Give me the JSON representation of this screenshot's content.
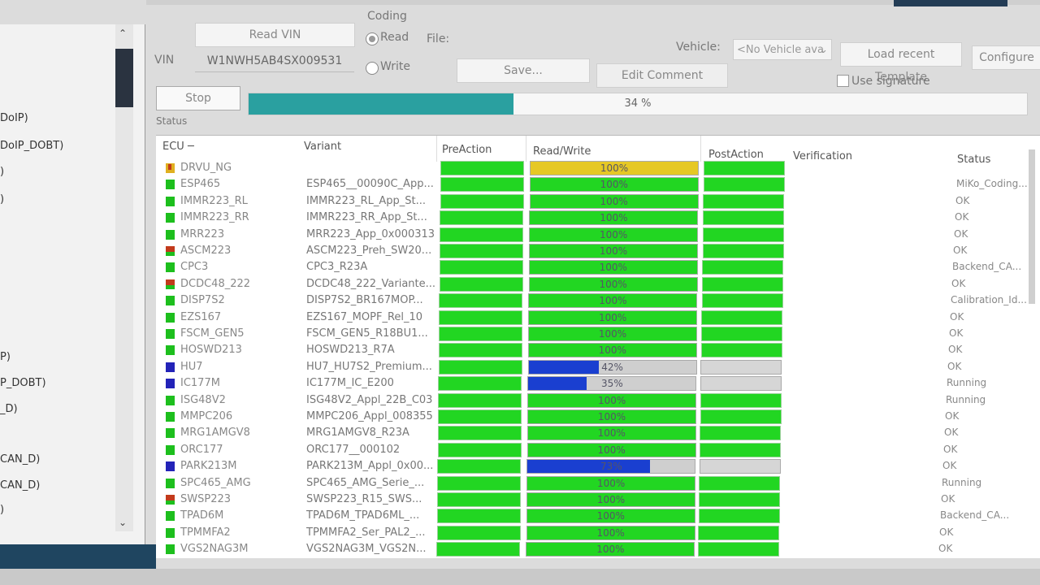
{
  "left_panel": {
    "items": [
      "DoIP)",
      "DoIP_DOBT)",
      ")",
      ")",
      "P)",
      "P_DOBT)",
      "_D)",
      "CAN_D)",
      "CAN_D)",
      ")"
    ]
  },
  "toolbar": {
    "read_vin_label": "Read VIN",
    "vin_label": "VIN",
    "vin_value": "W1NWH5AB4SX009531",
    "coding_label": "Coding",
    "read_label": "Read",
    "write_label": "Write",
    "file_label": "File:",
    "save_label": "Save...",
    "edit_comment_label": "Edit  Comment",
    "vehicle_label": "Vehicle:",
    "vehicle_value": "<No Vehicle ava",
    "load_template_label": "Load recent Template",
    "configure_label": "Configure",
    "use_signature_label": "Use signature",
    "stop_label": "Stop",
    "status_label": "Status"
  },
  "overall_progress": {
    "percent": 34,
    "label": "34 %"
  },
  "table": {
    "headers": {
      "ecu": "ECU",
      "variant": "Variant",
      "preaction": "PreAction",
      "readwrite": "Read/Write",
      "postaction": "PostAction",
      "verification": "Verification",
      "status": "Status"
    },
    "rows": [
      {
        "ecu": "DRVU_NG",
        "variant": "",
        "icon": "warning",
        "rw": 100,
        "rw_color": "yellow",
        "pct": "100%",
        "post": "green",
        "status": ""
      },
      {
        "ecu": "ESP465",
        "variant": "ESP465__00090C_App...",
        "icon": "ok",
        "rw": 100,
        "rw_color": "green",
        "pct": "100%",
        "post": "green",
        "status": "MiKo_Coding..."
      },
      {
        "ecu": "IMMR223_RL",
        "variant": "IMMR223_RL_App_St...",
        "icon": "ok",
        "rw": 100,
        "rw_color": "green",
        "pct": "100%",
        "post": "green",
        "status": "OK"
      },
      {
        "ecu": "IMMR223_RR",
        "variant": "IMMR223_RR_App_St...",
        "icon": "ok",
        "rw": 100,
        "rw_color": "green",
        "pct": "100%",
        "post": "green",
        "status": "OK"
      },
      {
        "ecu": "MRR223",
        "variant": "MRR223_App_0x000313",
        "icon": "ok",
        "rw": 100,
        "rw_color": "green",
        "pct": "100%",
        "post": "green",
        "status": "OK"
      },
      {
        "ecu": "ASCM223",
        "variant": "ASCM223_Preh_SW20...",
        "icon": "error",
        "rw": 100,
        "rw_color": "green",
        "pct": "100%",
        "post": "green",
        "status": "OK"
      },
      {
        "ecu": "CPC3",
        "variant": "CPC3_R23A",
        "icon": "ok",
        "rw": 100,
        "rw_color": "green",
        "pct": "100%",
        "post": "green",
        "status": "Backend_CA..."
      },
      {
        "ecu": "DCDC48_222",
        "variant": "DCDC48_222_Variante...",
        "icon": "error",
        "rw": 100,
        "rw_color": "green",
        "pct": "100%",
        "post": "green",
        "status": "OK"
      },
      {
        "ecu": "DISP7S2",
        "variant": "DISP7S2_BR167MOP...",
        "icon": "ok",
        "rw": 100,
        "rw_color": "green",
        "pct": "100%",
        "post": "green",
        "status": "Calibration_Id..."
      },
      {
        "ecu": "EZS167",
        "variant": "EZS167_MOPF_Rel_10",
        "icon": "ok",
        "rw": 100,
        "rw_color": "green",
        "pct": "100%",
        "post": "green",
        "status": "OK"
      },
      {
        "ecu": "FSCM_GEN5",
        "variant": "FSCM_GEN5_R18BU1...",
        "icon": "ok",
        "rw": 100,
        "rw_color": "green",
        "pct": "100%",
        "post": "green",
        "status": "OK"
      },
      {
        "ecu": "HOSWD213",
        "variant": "HOSWD213_R7A",
        "icon": "ok",
        "rw": 100,
        "rw_color": "green",
        "pct": "100%",
        "post": "green",
        "status": "OK"
      },
      {
        "ecu": "HU7",
        "variant": "HU7_HU7S2_Premium...",
        "icon": "running",
        "rw": 42,
        "rw_color": "blue",
        "pct": "42%",
        "post": "grey",
        "status": "OK"
      },
      {
        "ecu": "IC177M",
        "variant": "IC177M_IC_E200",
        "icon": "running",
        "rw": 35,
        "rw_color": "blue",
        "pct": "35%",
        "post": "grey",
        "status": "Running"
      },
      {
        "ecu": "ISG48V2",
        "variant": "ISG48V2_Appl_22B_C03",
        "icon": "ok",
        "rw": 100,
        "rw_color": "green",
        "pct": "100%",
        "post": "green",
        "status": "Running"
      },
      {
        "ecu": "MMPC206",
        "variant": "MMPC206_Appl_008355",
        "icon": "ok",
        "rw": 100,
        "rw_color": "green",
        "pct": "100%",
        "post": "green",
        "status": "OK"
      },
      {
        "ecu": "MRG1AMGV8",
        "variant": "MRG1AMGV8_R23A",
        "icon": "ok",
        "rw": 100,
        "rw_color": "green",
        "pct": "100%",
        "post": "green",
        "status": "OK"
      },
      {
        "ecu": "ORC177",
        "variant": "ORC177__000102",
        "icon": "ok",
        "rw": 100,
        "rw_color": "green",
        "pct": "100%",
        "post": "green",
        "status": "OK"
      },
      {
        "ecu": "PARK213M",
        "variant": "PARK213M_Appl_0x00...",
        "icon": "running",
        "rw": 73,
        "rw_color": "blue",
        "pct": "73%",
        "post": "grey",
        "status": "OK"
      },
      {
        "ecu": "SPC465_AMG",
        "variant": "SPC465_AMG_Serie_...",
        "icon": "ok",
        "rw": 100,
        "rw_color": "green",
        "pct": "100%",
        "post": "green",
        "status": "Running"
      },
      {
        "ecu": "SWSP223",
        "variant": "SWSP223_R15_SWS...",
        "icon": "error",
        "rw": 100,
        "rw_color": "green",
        "pct": "100%",
        "post": "green",
        "status": "OK"
      },
      {
        "ecu": "TPAD6M",
        "variant": "TPAD6M_TPAD6ML_...",
        "icon": "ok",
        "rw": 100,
        "rw_color": "green",
        "pct": "100%",
        "post": "green",
        "status": "Backend_CA..."
      },
      {
        "ecu": "TPMMFA2",
        "variant": "TPMMFA2_Ser_PAL2_...",
        "icon": "ok",
        "rw": 100,
        "rw_color": "green",
        "pct": "100%",
        "post": "green",
        "status": "OK"
      },
      {
        "ecu": "VGS2NAG3M",
        "variant": "VGS2NAG3M_VGS2N...",
        "icon": "ok",
        "rw": 100,
        "rw_color": "green",
        "pct": "100%",
        "post": "green",
        "status": "OK"
      }
    ]
  },
  "colors": {
    "ok_green": "#22d622",
    "running_blue": "#1a3fd0",
    "warning_yellow": "#e6c825",
    "overall_teal": "#2aa0a0",
    "error_red": "#c23a1b"
  }
}
